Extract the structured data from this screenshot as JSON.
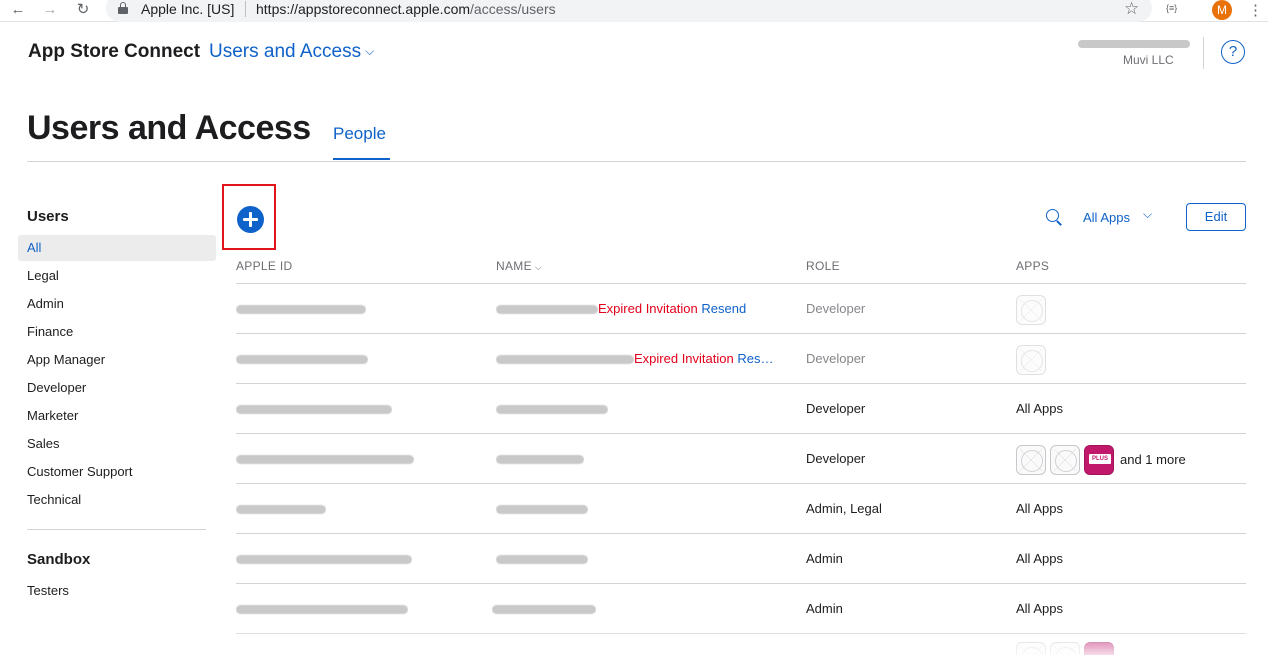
{
  "browser": {
    "back_icon": "←",
    "forward_icon": "→",
    "reload_icon": "↻",
    "cert": "Apple Inc. [US]",
    "url_host": "https://appstoreconnect.apple.com",
    "url_path": "/access/users",
    "star_icon": "☆",
    "ext_label": "{≡}",
    "profile_initial": "M",
    "menu_icon": "⋮"
  },
  "header": {
    "brand": "App Store Connect",
    "section": "Users and Access",
    "section_chevron": "⌵",
    "account_org": "Muvi LLC",
    "help_label": "?"
  },
  "page": {
    "title": "Users and Access",
    "tab": "People"
  },
  "sidebar": {
    "users_heading": "Users",
    "items": [
      {
        "label": "All",
        "active": true
      },
      {
        "label": "Legal"
      },
      {
        "label": "Admin"
      },
      {
        "label": "Finance"
      },
      {
        "label": "App Manager"
      },
      {
        "label": "Developer"
      },
      {
        "label": "Marketer"
      },
      {
        "label": "Sales"
      },
      {
        "label": "Customer Support"
      },
      {
        "label": "Technical"
      }
    ],
    "sandbox_heading": "Sandbox",
    "sandbox_items": [
      {
        "label": "Testers"
      }
    ]
  },
  "toolbar": {
    "filter_label": "All Apps",
    "filter_chevron": "⌵",
    "edit_label": "Edit"
  },
  "table": {
    "columns": [
      "APPLE ID",
      "NAME",
      "ROLE",
      "APPS"
    ],
    "name_sort_icon": "⌵",
    "rows": [
      {
        "role": "Developer",
        "status": "Expired Invitation",
        "action": "Resend",
        "apps": "icons",
        "icon_count": 1,
        "more": ""
      },
      {
        "role": "Developer",
        "status": "Expired Invitation",
        "action": "Res…",
        "apps": "icons",
        "icon_count": 1,
        "more": ""
      },
      {
        "role": "Developer",
        "apps_text": "All Apps"
      },
      {
        "role": "Developer",
        "apps": "icons",
        "icon_count": 3,
        "more": "and 1 more"
      },
      {
        "role": "Admin, Legal",
        "apps_text": "All Apps"
      },
      {
        "role": "Admin",
        "apps_text": "All Apps"
      },
      {
        "role": "Admin",
        "apps_text": "All Apps"
      }
    ],
    "plus_icon_text": "PLUS"
  },
  "colors": {
    "accent": "#0f62c9",
    "expired": "#e3001b",
    "highlight_box": "#e0161c"
  }
}
